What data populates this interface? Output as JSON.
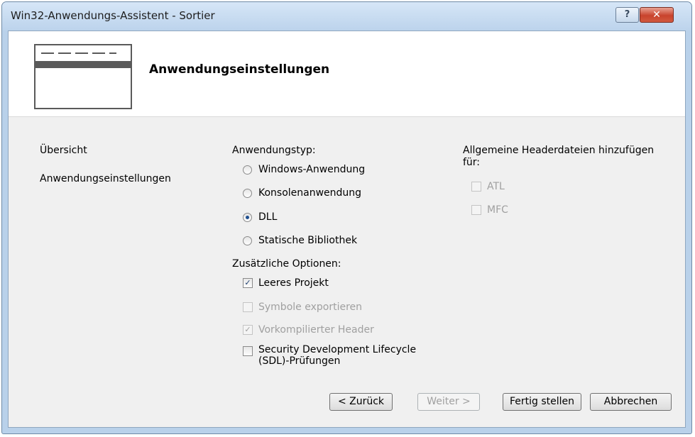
{
  "window": {
    "title": "Win32-Anwendungs-Assistent - Sortier",
    "help_label": "?",
    "close_label": "✕"
  },
  "header": {
    "title": "Anwendungseinstellungen",
    "icon": "wizard-window-icon"
  },
  "nav": {
    "items": [
      "Übersicht",
      "Anwendungseinstellungen"
    ]
  },
  "app_type": {
    "label": "Anwendungstyp:",
    "options": [
      {
        "label": "Windows-Anwendung",
        "selected": false
      },
      {
        "label": "Konsolenanwendung",
        "selected": false
      },
      {
        "label": "DLL",
        "selected": true
      },
      {
        "label": "Statische Bibliothek",
        "selected": false
      }
    ]
  },
  "options": {
    "label": "Zusätzliche Optionen:",
    "items": [
      {
        "label": "Leeres Projekt",
        "checked": true,
        "enabled": true
      },
      {
        "label": "Symbole exportieren",
        "checked": false,
        "enabled": false
      },
      {
        "label": "Vorkompilierter Header",
        "checked": true,
        "enabled": false
      },
      {
        "label_line1": "Security Development Lifecycle",
        "label_line2": "(SDL)-Prüfungen",
        "checked": false,
        "enabled": true
      }
    ]
  },
  "headers": {
    "label_line1": "Allgemeine Headerdateien hinzufügen",
    "label_line2": "für:",
    "items": [
      {
        "label": "ATL",
        "checked": false,
        "enabled": false
      },
      {
        "label": "MFC",
        "checked": false,
        "enabled": false
      }
    ]
  },
  "buttons": {
    "back": "< Zurück",
    "next": "Weiter >",
    "finish": "Fertig stellen",
    "cancel": "Abbrechen"
  },
  "colors": {
    "frame": "#b9d1ea",
    "body": "#f0f0f0",
    "close": "#c8432d"
  }
}
